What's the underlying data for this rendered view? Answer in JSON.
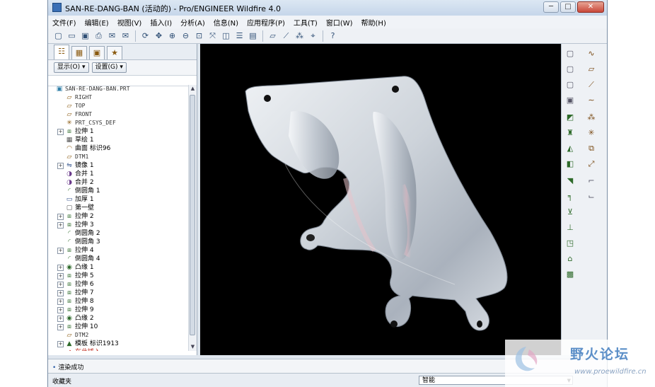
{
  "window": {
    "title": "SAN-RE-DANG-BAN (活动的) - Pro/ENGINEER Wildfire 4.0",
    "min_label": "─",
    "max_label": "□",
    "close_label": "✕"
  },
  "menu": [
    "文件(F)",
    "编辑(E)",
    "视图(V)",
    "插入(I)",
    "分析(A)",
    "信息(N)",
    "应用程序(P)",
    "工具(T)",
    "窗口(W)",
    "帮助(H)"
  ],
  "toolbar_icons": [
    "new-icon",
    "open-icon",
    "save-icon",
    "print-icon",
    "email-icon",
    "email-link-icon",
    "regenerate-icon",
    "pan-icon",
    "zoom-in-icon",
    "zoom-out-icon",
    "refit-icon",
    "reorient-icon",
    "saved-views-icon",
    "layers-icon",
    "view-manager-icon",
    "datum-plane-display-icon",
    "datum-axis-display-icon",
    "datum-point-display-icon",
    "csys-display-icon",
    "context-help-icon"
  ],
  "left_panel": {
    "tabs": [
      "model-tree-tab-icon",
      "layer-tab-icon",
      "folder-tab-icon",
      "favorites-tab-icon"
    ],
    "show_label": "显示(O) ▾",
    "settings_label": "设置(G) ▾"
  },
  "tree": [
    {
      "label": "SAN-RE-DANG-BAN.PRT",
      "icon": "part-icon",
      "expander": "",
      "root": true
    },
    {
      "label": "RIGHT",
      "icon": "datum-plane-icon",
      "expander": ""
    },
    {
      "label": "TOP",
      "icon": "datum-plane-icon",
      "expander": ""
    },
    {
      "label": "FRONT",
      "icon": "datum-plane-icon",
      "expander": ""
    },
    {
      "label": "PRT_CSYS_DEF",
      "icon": "csys-icon",
      "expander": ""
    },
    {
      "label": "拉伸 1",
      "icon": "extrude-icon",
      "expander": "+"
    },
    {
      "label": "草绘 1",
      "icon": "sketch-icon",
      "expander": ""
    },
    {
      "label": "曲面 标识96",
      "icon": "surface-icon",
      "expander": ""
    },
    {
      "label": "DTM1",
      "icon": "datum-plane-icon",
      "expander": ""
    },
    {
      "label": "镜像 1",
      "icon": "mirror-icon",
      "expander": "+"
    },
    {
      "label": "合并 1",
      "icon": "merge-icon",
      "expander": ""
    },
    {
      "label": "合并 2",
      "icon": "merge-icon",
      "expander": ""
    },
    {
      "label": "倒圆角 1",
      "icon": "round-icon",
      "expander": ""
    },
    {
      "label": "加厚 1",
      "icon": "thicken-icon",
      "expander": ""
    },
    {
      "label": "第一壁",
      "icon": "first-wall-icon",
      "expander": ""
    },
    {
      "label": "拉伸 2",
      "icon": "extrude-icon",
      "expander": "+"
    },
    {
      "label": "拉伸 3",
      "icon": "extrude-icon",
      "expander": "+"
    },
    {
      "label": "倒圆角 2",
      "icon": "round-icon",
      "expander": ""
    },
    {
      "label": "倒圆角 3",
      "icon": "round-icon",
      "expander": ""
    },
    {
      "label": "拉伸 4",
      "icon": "extrude-icon",
      "expander": "+"
    },
    {
      "label": "倒圆角 4",
      "icon": "round-icon",
      "expander": ""
    },
    {
      "label": "凸缘 1",
      "icon": "flange-icon",
      "expander": "+"
    },
    {
      "label": "拉伸 5",
      "icon": "extrude-icon",
      "expander": "+"
    },
    {
      "label": "拉伸 6",
      "icon": "extrude-icon",
      "expander": "+"
    },
    {
      "label": "拉伸 7",
      "icon": "extrude-icon",
      "expander": "+"
    },
    {
      "label": "拉伸 8",
      "icon": "extrude-icon",
      "expander": "+"
    },
    {
      "label": "拉伸 9",
      "icon": "extrude-icon",
      "expander": "+"
    },
    {
      "label": "凸缘 2",
      "icon": "flange-icon",
      "expander": "+"
    },
    {
      "label": "拉伸 10",
      "icon": "extrude-icon",
      "expander": "+"
    },
    {
      "label": "DTM2",
      "icon": "datum-plane-icon",
      "expander": ""
    },
    {
      "label": "模板 标识1913",
      "icon": "form-icon",
      "expander": "+"
    },
    {
      "label": "在此插入",
      "icon": "insert-here-icon",
      "expander": ""
    }
  ],
  "right_tools": [
    "sheetmetal-convert-icon",
    "sketch-datum-curve-icon",
    "flat-wall-icon",
    "datum-plane-tool-icon",
    "flange-wall-icon",
    "datum-axis-tool-icon",
    "extend-wall-icon",
    "datum-curve-tool-icon",
    "blend-wall-icon",
    "datum-point-tool-icon",
    "twist-wall-icon",
    "csys-tool-icon",
    "sheetmetal-cut-icon",
    "analysis-feature-icon",
    "punch-icon",
    "sketched-form-icon",
    "bend-icon",
    "rip-icon",
    "unbend-icon",
    "bend-back-icon",
    "flatten-icon",
    "edge-rip-icon",
    "form-tool-icon",
    "flat-pattern-icon",
    "corner-relief-icon"
  ],
  "status": {
    "message": "渲染成功",
    "favorites": "收藏夹",
    "smart_filter": "智能"
  },
  "watermark": {
    "text": "野火论坛",
    "url": "www.proewildfire.cn"
  }
}
